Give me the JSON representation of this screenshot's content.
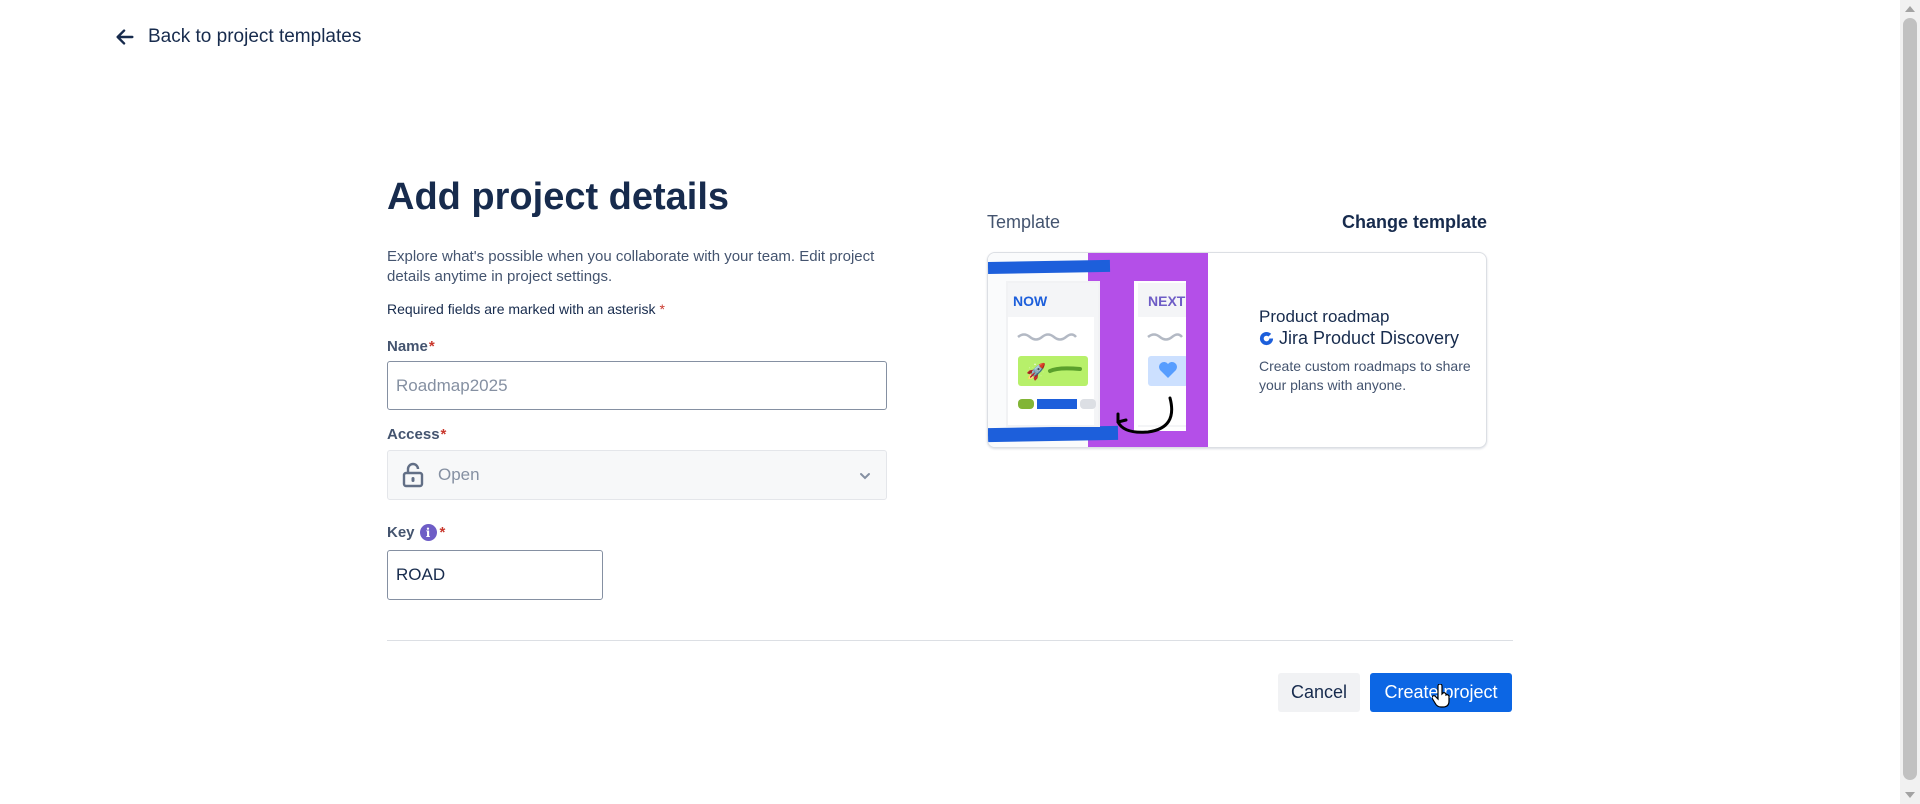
{
  "nav": {
    "back_label": "Back to project templates"
  },
  "form": {
    "title": "Add project details",
    "description": "Explore what's possible when you collaborate with your team. Edit project details anytime in project settings.",
    "required_note": "Required fields are marked with an asterisk",
    "asterisk": "*",
    "name": {
      "label": "Name",
      "placeholder": "Roadmap2025",
      "value": ""
    },
    "access": {
      "label": "Access",
      "value": "Open"
    },
    "key": {
      "label": "Key",
      "info_symbol": "i",
      "value": "ROAD"
    }
  },
  "template": {
    "section_label": "Template",
    "change_label": "Change template",
    "card": {
      "title": "Product roadmap",
      "product": "Jira Product Discovery",
      "description": "Create custom roadmaps to share your plans with anyone.",
      "columns": [
        "NOW",
        "NEXT"
      ]
    }
  },
  "actions": {
    "cancel_label": "Cancel",
    "create_label": "Create project"
  },
  "colors": {
    "primary": "#0c66e4",
    "text": "#172b4d",
    "subtle": "#44546f",
    "required": "#c9372c",
    "accent_purple": "#b44fe8"
  },
  "icons": [
    "arrow-left-icon",
    "lock-icon",
    "chevron-down-icon",
    "info-icon",
    "jira-product-discovery-icon",
    "mouse-cursor-icon"
  ]
}
